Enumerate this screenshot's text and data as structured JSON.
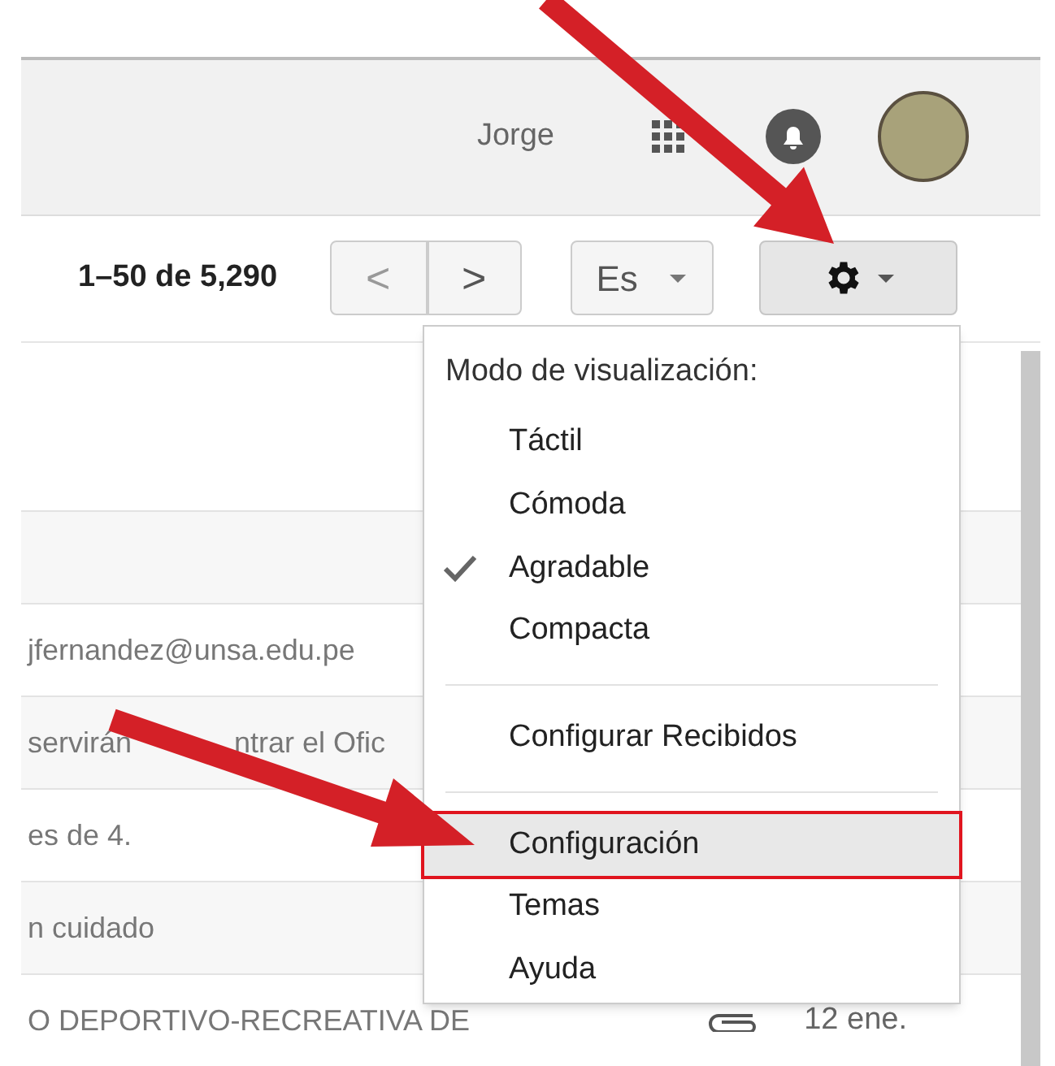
{
  "header": {
    "user_name": "Jorge"
  },
  "toolbar": {
    "page_range": "1–50 de 5,290",
    "prev_label": "<",
    "next_label": ">",
    "language": "Es"
  },
  "email_rows": [
    {
      "text": ""
    },
    {
      "text": "jfernandez@unsa.edu.pe"
    },
    {
      "text": "servirán",
      "text_2": "ntrar el Ofic"
    },
    {
      "text": "es de 4."
    },
    {
      "text": "n cuidado"
    },
    {
      "text": "O DEPORTIVO-RECREATIVA DE",
      "attachment": true,
      "date": "12 ene."
    }
  ],
  "settings_menu": {
    "heading": "Modo de visualización:",
    "items": [
      {
        "kind": "option",
        "label": "Táctil",
        "checked": false,
        "selected": false
      },
      {
        "kind": "option",
        "label": "Cómoda",
        "checked": false,
        "selected": false
      },
      {
        "kind": "option",
        "label": "Agradable",
        "checked": true,
        "selected": false
      },
      {
        "kind": "option",
        "label": "Compacta",
        "checked": false,
        "selected": false
      },
      {
        "kind": "divider"
      },
      {
        "kind": "action",
        "label": "Configurar Recibidos",
        "selected": false
      },
      {
        "kind": "divider"
      },
      {
        "kind": "action",
        "label": "Configuración",
        "selected": true
      },
      {
        "kind": "action",
        "label": "Temas",
        "selected": false
      },
      {
        "kind": "action",
        "label": "Ayuda",
        "selected": false
      }
    ]
  }
}
